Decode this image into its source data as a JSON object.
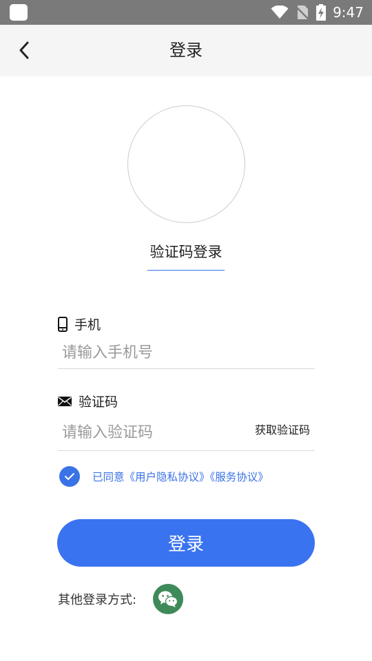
{
  "status_bar": {
    "time": "9:47"
  },
  "header": {
    "title": "登录"
  },
  "tab": {
    "label": "验证码登录"
  },
  "phone": {
    "label": "手机",
    "placeholder": "请输入手机号",
    "value": ""
  },
  "code": {
    "label": "验证码",
    "placeholder": "请输入验证码",
    "value": "",
    "get_code_label": "获取验证码"
  },
  "agreement": {
    "checked": true,
    "prefix": "已同意",
    "privacy_link": "《用户隐私协议》",
    "service_link": "《服务协议》"
  },
  "login_button": {
    "label": "登录"
  },
  "other_login": {
    "label": "其他登录方式:"
  },
  "colors": {
    "accent": "#3a73f0",
    "wechat": "#3f8a5a",
    "header_bg": "#f5f5f5",
    "status_bar": "#7a7a7a"
  }
}
